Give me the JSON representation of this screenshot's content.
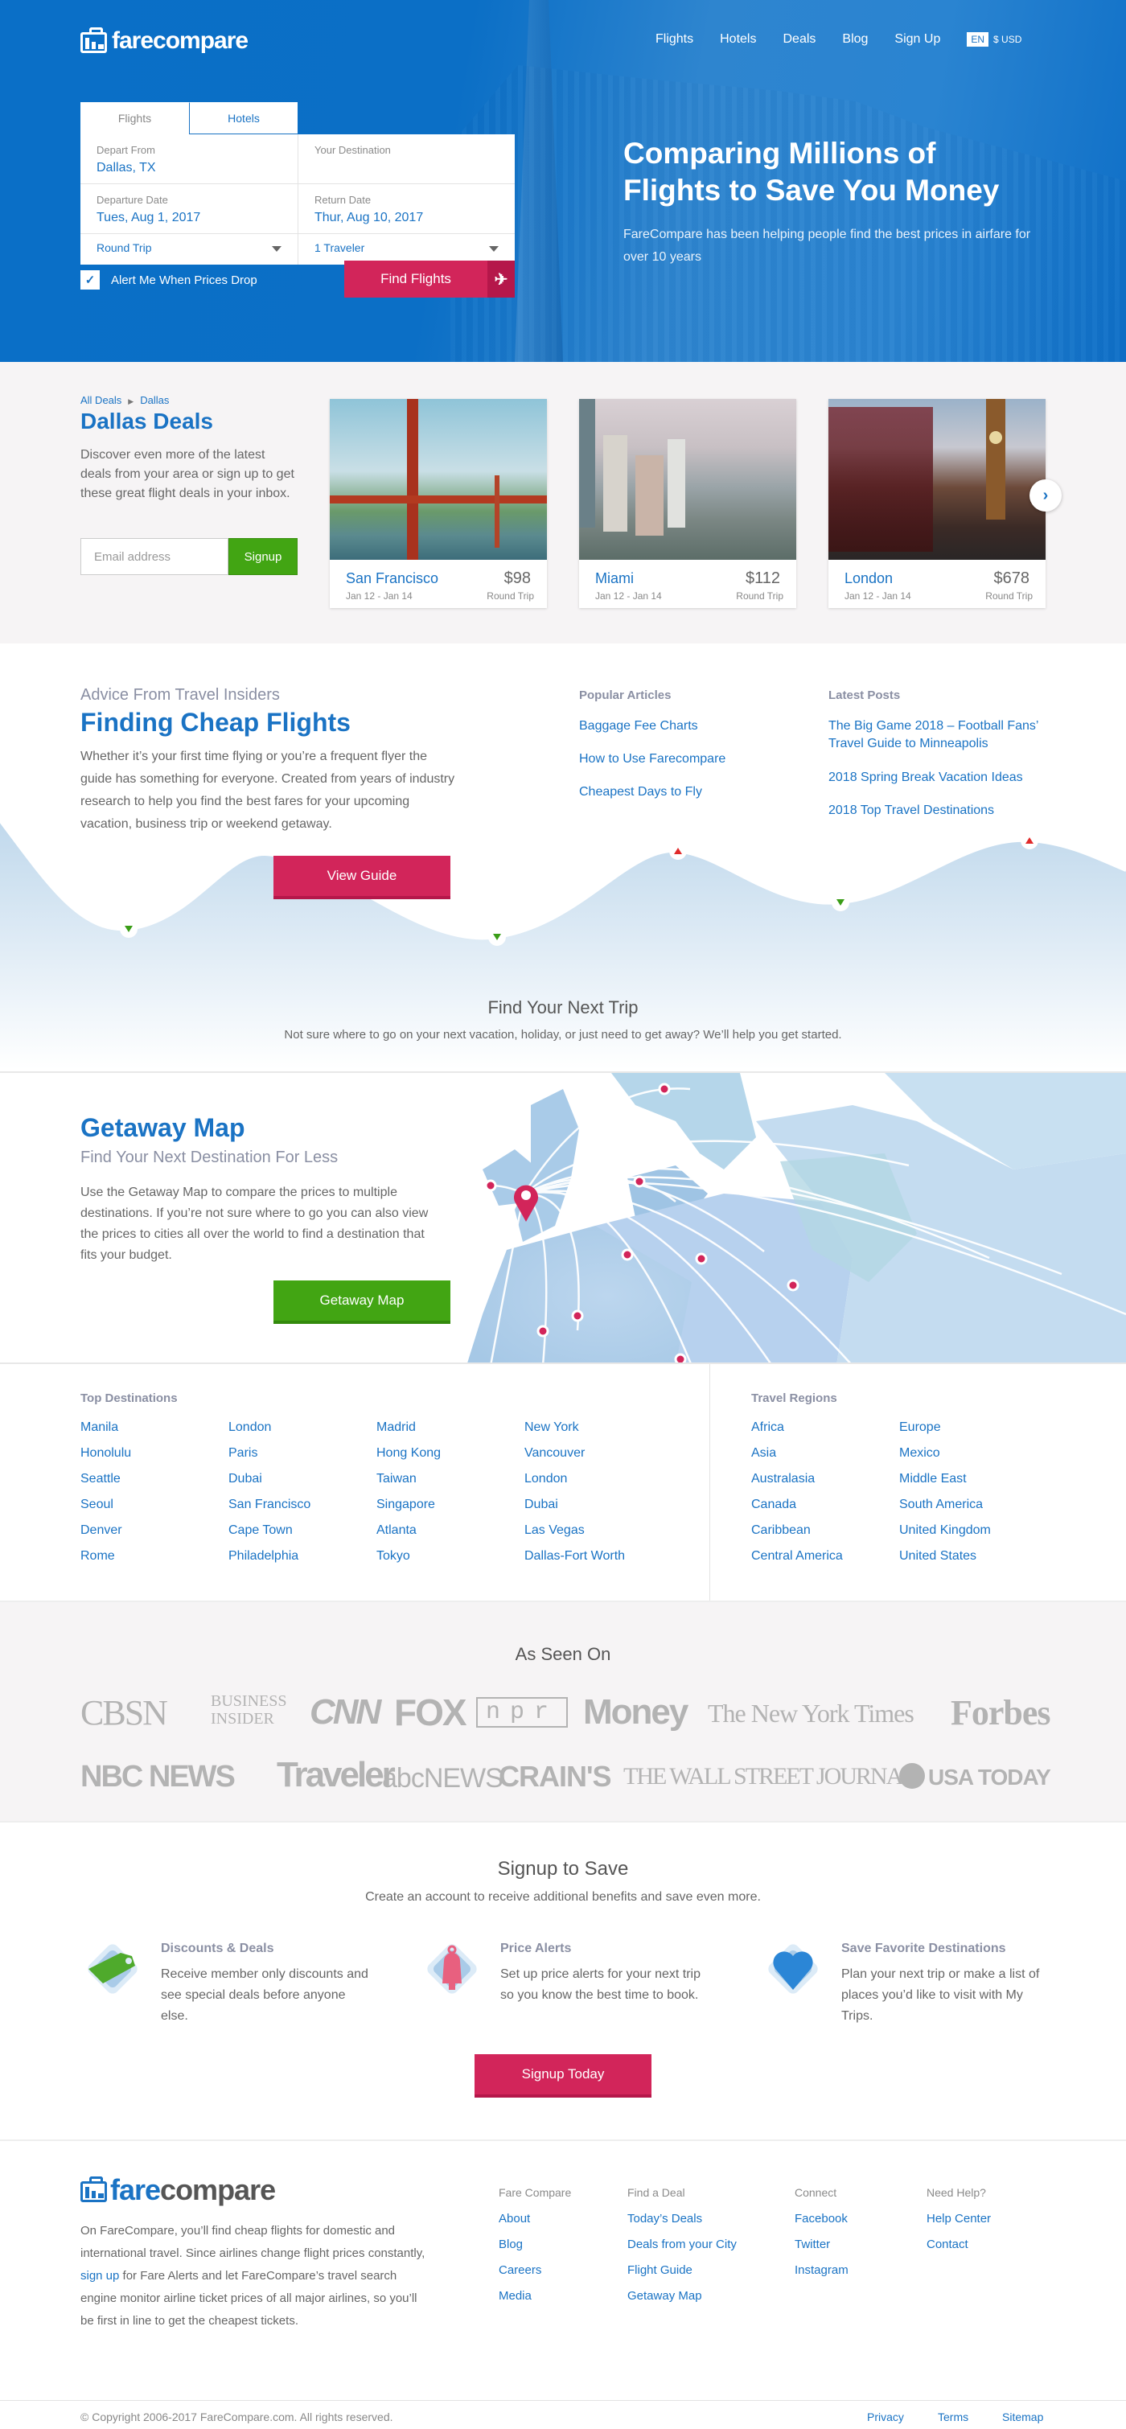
{
  "colors": {
    "brand_blue": "#0b6fc6",
    "link_blue": "#1a73c4",
    "cta_pink": "#d2255a",
    "cta_green": "#42a513",
    "muted_heading": "#8a8fa3"
  },
  "header": {
    "logo_text": "farecompare",
    "nav": [
      "Flights",
      "Hotels",
      "Deals",
      "Blog",
      "Sign Up"
    ],
    "language": "EN",
    "currency": "$ USD"
  },
  "search": {
    "tabs": [
      {
        "label": "Flights",
        "active": true
      },
      {
        "label": "Hotels",
        "active": false
      }
    ],
    "depart_label": "Depart From",
    "depart_value": "Dallas, TX",
    "dest_label": "Your Destination",
    "dest_value": "",
    "departure_date_label": "Departure Date",
    "departure_date_value": "Tues, Aug 1, 2017",
    "return_date_label": "Return Date",
    "return_date_value": "Thur, Aug 10, 2017",
    "trip_type": "Round Trip",
    "travelers": "1 Traveler",
    "alert_label": "Alert Me When Prices Drop",
    "alert_checked": true,
    "find_button": "Find Flights"
  },
  "hero": {
    "headline_line1": "Comparing Millions of",
    "headline_line2": "Flights to Save You Money",
    "subtext": "FareCompare has been helping people find the best prices in airfare for over 10 years"
  },
  "deals": {
    "breadcrumb": [
      "All Deals",
      "Dallas"
    ],
    "title": "Dallas Deals",
    "description": "Discover even more of the latest deals from your area or sign up to get these great flight deals in your inbox.",
    "email_placeholder": "Email address",
    "signup_button": "Signup",
    "cards": [
      {
        "city": "San Francisco",
        "dates": "Jan 12 - Jan 14",
        "price": "$98",
        "trip": "Round Trip",
        "image": "golden-gate-bridge"
      },
      {
        "city": "Miami",
        "dates": "Jan 12 - Jan 14",
        "price": "$112",
        "trip": "Round Trip",
        "image": "miami-skyline"
      },
      {
        "city": "London",
        "dates": "Jan 12 - Jan 14",
        "price": "$678",
        "trip": "Round Trip",
        "image": "big-ben-bus"
      }
    ]
  },
  "guide": {
    "subtitle": "Advice From Travel Insiders",
    "title": "Finding Cheap Flights",
    "description": "Whether it’s your first time flying or you’re a frequent flyer the guide has something for everyone. Created from years of industry research to help you find the best fares for your upcoming vacation, business trip or weekend getaway.",
    "button": "View Guide",
    "popular_heading": "Popular Articles",
    "popular": [
      "Baggage Fee Charts",
      "How to Use Farecompare",
      "Cheapest Days to Fly"
    ],
    "latest_heading": "Latest Posts",
    "latest": [
      "The Big Game 2018 – Football Fans’ Travel Guide to Minneapolis",
      "2018 Spring Break Vacation Ideas",
      "2018 Top Travel Destinations"
    ],
    "next_trip_title": "Find Your Next Trip",
    "next_trip_text": "Not sure where to go on your next vacation, holiday, or just need to get away? We’ll help you get started."
  },
  "getaway": {
    "title": "Getaway Map",
    "subtitle": "Find Your Next Destination For Less",
    "description": "Use the Getaway Map to compare the prices to multiple destinations. If you’re not sure where to go you can also view the prices to cities all over the world to find a destination that fits your budget.",
    "button": "Getaway Map"
  },
  "destinations": {
    "heading": "Top Destinations",
    "columns": [
      [
        "Manila",
        "Honolulu",
        "Seattle",
        "Seoul",
        "Denver",
        "Rome"
      ],
      [
        "London",
        "Paris",
        "Dubai",
        "San Francisco",
        "Cape Town",
        "Philadelphia"
      ],
      [
        "Madrid",
        "Hong Kong",
        "Taiwan",
        "Singapore",
        "Atlanta",
        "Tokyo"
      ],
      [
        "New York",
        "Vancouver",
        "London",
        "Dubai",
        "Las Vegas",
        "Dallas-Fort Worth"
      ]
    ],
    "regions_heading": "Travel Regions",
    "regions": [
      [
        "Africa",
        "Asia",
        "Australasia",
        "Canada",
        "Caribbean",
        "Central America"
      ],
      [
        "Europe",
        "Mexico",
        "Middle East",
        "South America",
        "United Kingdom",
        "United States"
      ]
    ]
  },
  "seen_on": {
    "title": "As Seen On",
    "logos_row1": [
      "CBSN",
      "BUSINESS INSIDER",
      "CNN",
      "FOX",
      "npr",
      "Money",
      "The New York Times",
      "Forbes"
    ],
    "logos_row2": [
      "NBC NEWS",
      "Traveler",
      "abcNEWS",
      "CRAIN'S",
      "THE WALL STREET JOURNAL",
      "USA TODAY"
    ]
  },
  "signup_save": {
    "title": "Signup to Save",
    "subtitle": "Create an account to receive additional benefits and save even more.",
    "features": [
      {
        "icon": "price-tag",
        "title": "Discounts & Deals",
        "text": "Receive member only discounts and see special deals before anyone else."
      },
      {
        "icon": "bell",
        "title": "Price Alerts",
        "text": "Set up price alerts for your next trip so you know the best time to book."
      },
      {
        "icon": "heart",
        "title": "Save Favorite Destinations",
        "text": "Plan your next trip or make a list of places you’d like to visit with My Trips."
      }
    ],
    "button": "Signup Today"
  },
  "footer": {
    "logo_part1": "fare",
    "logo_part2": "compare",
    "about_before": "On FareCompare, you’ll find cheap flights for domestic and international travel. Since airlines change flight prices constantly, ",
    "about_link": "sign up",
    "about_after": " for Fare Alerts and let FareCompare’s travel search engine monitor airline ticket prices of all major airlines, so you’ll be first in line to get the cheapest tickets.",
    "columns": [
      {
        "heading": "Fare Compare",
        "links": [
          "About",
          "Blog",
          "Careers",
          "Media"
        ]
      },
      {
        "heading": "Find a Deal",
        "links": [
          "Today’s Deals",
          "Deals from your City",
          "Flight Guide",
          "Getaway Map"
        ]
      },
      {
        "heading": "Connect",
        "links": [
          "Facebook",
          "Twitter",
          "Instagram"
        ]
      },
      {
        "heading": "Need Help?",
        "links": [
          "Help Center",
          "Contact"
        ]
      }
    ],
    "copyright": "© Copyright 2006-2017 FareCompare.com. All rights reserved.",
    "bottom_links": [
      "Privacy",
      "Terms",
      "Sitemap"
    ]
  }
}
